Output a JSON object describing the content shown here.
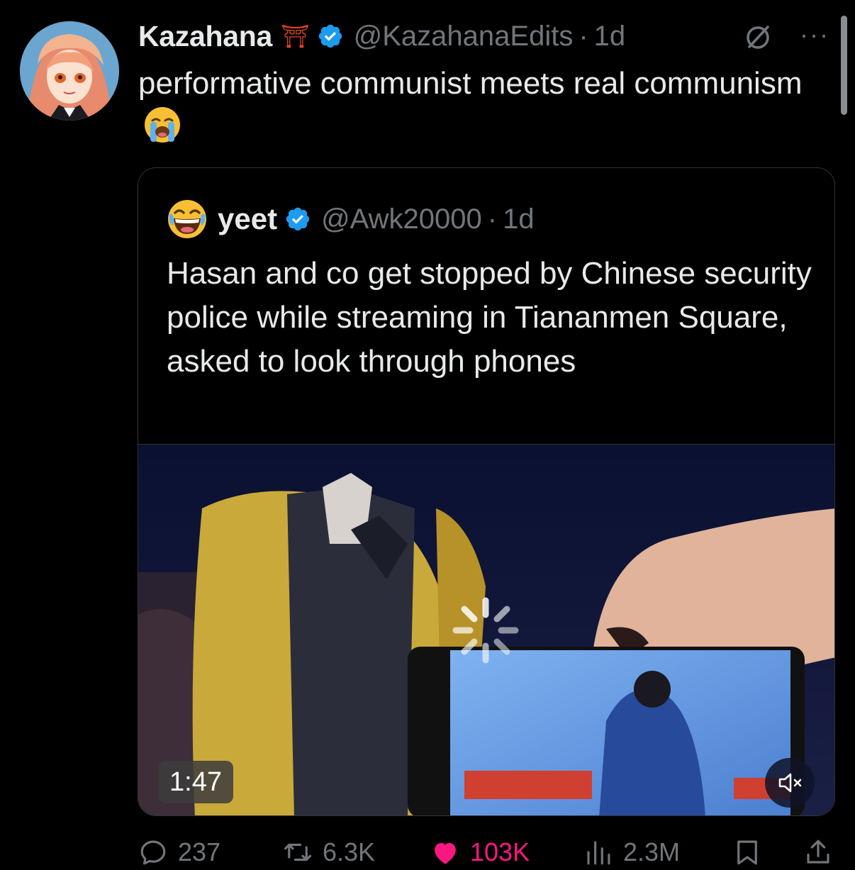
{
  "tweet": {
    "author": {
      "display_name": "Kazahana",
      "name_emoji": "⛩",
      "handle": "@KazahanaEdits",
      "separator": "·",
      "time": "1d"
    },
    "text": "performative communist meets real communism",
    "text_emoji": "loudly-crying-face"
  },
  "quote": {
    "author": {
      "display_name": "yeet",
      "handle": "@Awk20000",
      "separator": "·",
      "time": "1d"
    },
    "text": "Hasan and co get stopped by Chinese security police while streaming in Tiananmen Square, asked to look through phones",
    "video": {
      "duration": "1:47",
      "muted": true
    }
  },
  "actions": {
    "replies": "237",
    "reposts": "6.3K",
    "likes": "103K",
    "views": "2.3M"
  },
  "colors": {
    "background": "#000000",
    "text": "#e7e9ea",
    "secondary": "#71767b",
    "verified": "#1d9bf0",
    "like": "#f91880",
    "border": "#2f3336"
  }
}
